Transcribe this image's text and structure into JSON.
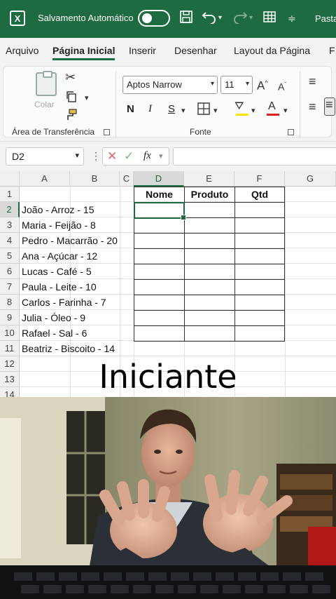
{
  "titlebar": {
    "logo": "X",
    "autosave_label": "Salvamento Automático",
    "autosave_state": "off",
    "file_name": "Pasta"
  },
  "menu": {
    "tabs": [
      "Arquivo",
      "Página Inicial",
      "Inserir",
      "Desenhar",
      "Layout da Página",
      "F"
    ],
    "active_index": 1
  },
  "ribbon": {
    "paste_label": "Colar",
    "clipboard_group": "Área de Transferência",
    "font_group": "Fonte",
    "font_name": "Aptos Narrow",
    "font_size": "11",
    "bold": "N",
    "italic": "I",
    "underline": "S"
  },
  "formula_bar": {
    "name_box": "D2",
    "fx": "fx",
    "content": ""
  },
  "sheet": {
    "columns": [
      "A",
      "B",
      "C",
      "D",
      "E",
      "F",
      "G"
    ],
    "rows": [
      "1",
      "2",
      "3",
      "4",
      "5",
      "6",
      "7",
      "8",
      "9",
      "10",
      "11",
      "12",
      "13",
      "14"
    ],
    "selected_cell": "D2",
    "column_a_values": [
      "João - Arroz - 15",
      "Maria - Feijão - 8",
      "Pedro - Macarrão - 20",
      "Ana - Açúcar - 12",
      "Lucas - Café - 5",
      "Paula - Leite - 10",
      "Carlos - Farinha - 7",
      "Julia - Óleo - 9",
      "Rafael - Sal - 6",
      "Beatriz - Biscoito - 14"
    ],
    "table_headers": [
      "Nome",
      "Produto",
      "Qtd"
    ]
  },
  "caption": "Iniciante",
  "colors": {
    "excel_green": "#1e6b41",
    "font_color_red": "#e02020",
    "highlight_yellow": "#ffe600"
  }
}
